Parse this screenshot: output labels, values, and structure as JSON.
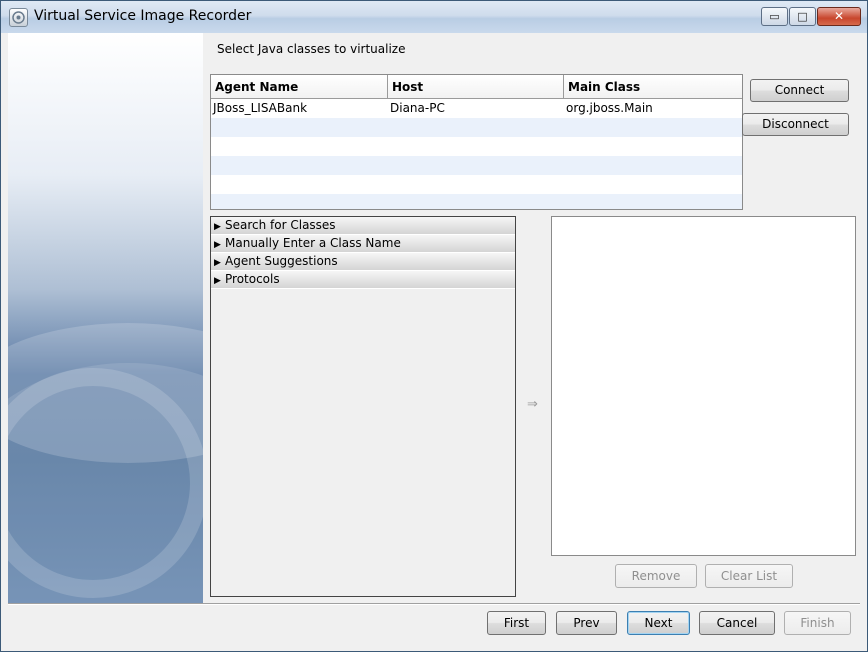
{
  "window": {
    "title": "Virtual Service Image Recorder",
    "controls": {
      "minimize": "▭",
      "maximize": "□",
      "close": "✕"
    }
  },
  "main": {
    "instruction": "Select Java classes to virtualize"
  },
  "agents_table": {
    "columns": [
      "Agent Name",
      "Host",
      "Main Class"
    ],
    "rows": [
      {
        "agent_name": "JBoss_LISABank",
        "host": "Diana-PC",
        "main_class": "org.jboss.Main"
      }
    ]
  },
  "agent_buttons": {
    "connect": "Connect",
    "disconnect": "Disconnect"
  },
  "accordion": {
    "items": [
      "Search for Classes",
      "Manually Enter a Class Name",
      "Agent Suggestions",
      "Protocols"
    ],
    "expander_icon": "triangle-right-icon"
  },
  "transfer": {
    "icon": "arrow-right-icon",
    "glyph": "⇒"
  },
  "list_buttons": {
    "remove": "Remove",
    "clear_list": "Clear List"
  },
  "wizard_buttons": {
    "first": "First",
    "prev": "Prev",
    "next": "Next",
    "cancel": "Cancel",
    "finish": "Finish"
  },
  "colors": {
    "selection_alt_row": "#eaf1fb",
    "default_button_border": "#3c7fb1"
  }
}
